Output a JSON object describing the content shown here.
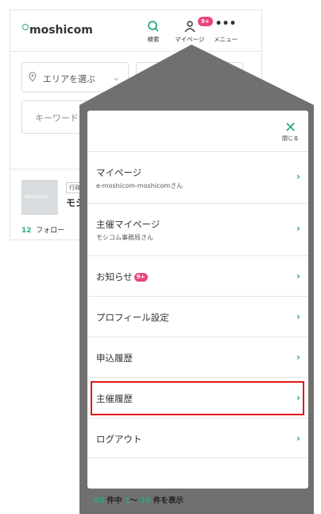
{
  "app": {
    "logo": "moshicom",
    "nav": {
      "search_label": "検索",
      "mypage_label": "マイページ",
      "mypage_badge": "9+",
      "menu_label": "メニュー"
    },
    "area_select": "エリアを選ぶ",
    "keyword_placeholder": "キーワード",
    "card": {
      "thumb_text": "Moshicom",
      "tag": "行政",
      "org_name": "モシ",
      "follow_count": "12",
      "follow_label": "フォロー"
    }
  },
  "modal": {
    "close_label": "閉じる",
    "items": [
      {
        "title": "マイページ",
        "subtitle": "e-moshicom-moshicomさん"
      },
      {
        "title": "主催マイページ",
        "subtitle": "モシコム事務局さん"
      },
      {
        "title": "お知らせ",
        "badge": "9+"
      },
      {
        "title": "プロフィール設定"
      },
      {
        "title": "申込履歴"
      },
      {
        "title": "主催履歴"
      },
      {
        "title": "ログアウト"
      }
    ]
  },
  "results": {
    "total": "84",
    "unit": "件中",
    "range_start": "1",
    "range_sep": "〜",
    "range_end": "10",
    "suffix": "件を表示"
  },
  "colors": {
    "accent": "#2aa87a",
    "badge": "#e9457a",
    "overlay": "#707070",
    "highlight": "#e01818"
  }
}
